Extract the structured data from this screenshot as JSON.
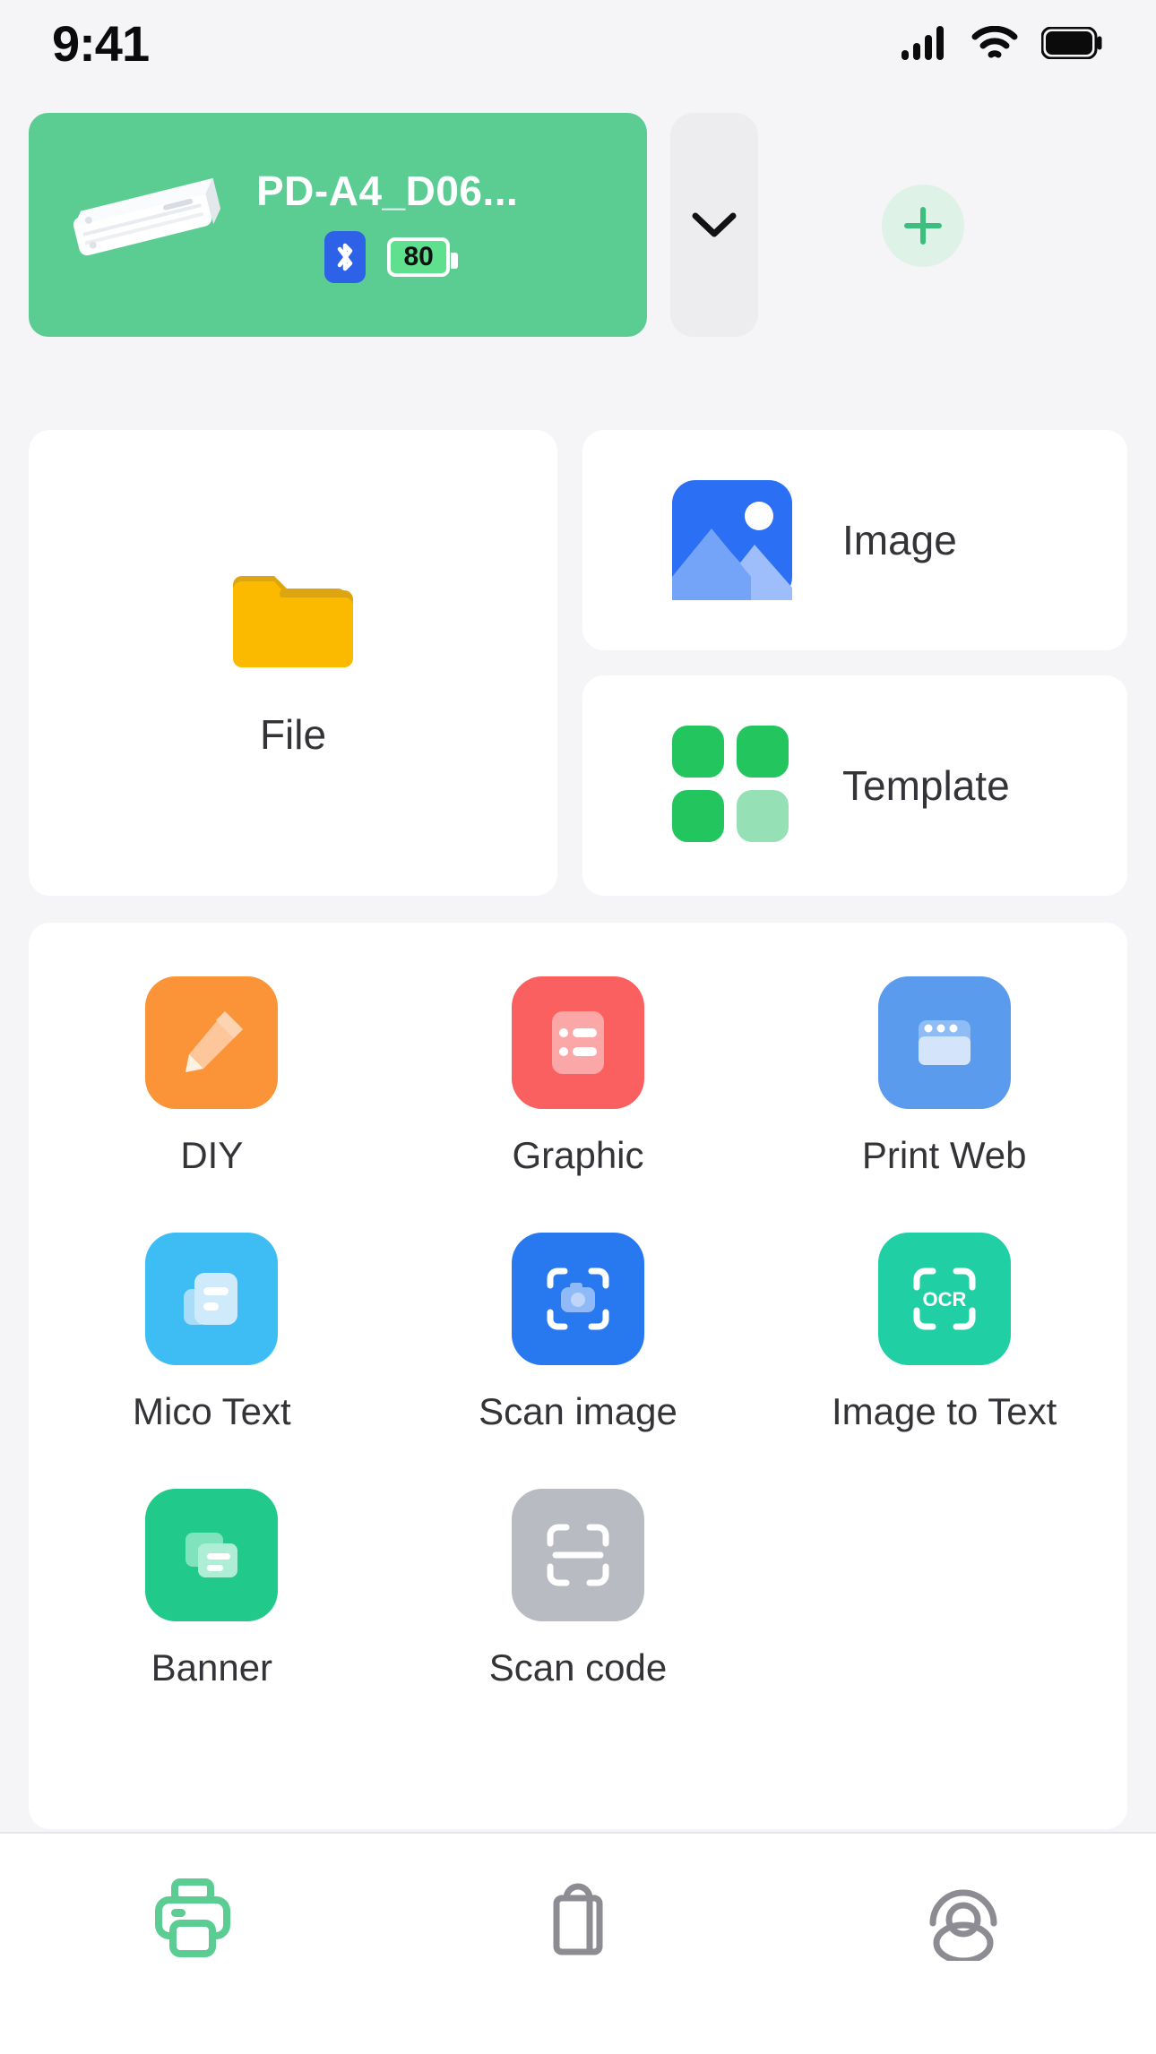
{
  "status_bar": {
    "time": "9:41",
    "icons": [
      "signal-icon",
      "wifi-icon",
      "battery-icon"
    ]
  },
  "device": {
    "name": "PD-A4_D06...",
    "product_image": "printer-illustration",
    "bluetooth_icon": "bluetooth-icon",
    "battery_level": "80",
    "expand_icon": "chevron-down-icon",
    "add_icon": "plus-icon",
    "card_color": "#5BCC92",
    "bluetooth_color": "#2D61E8",
    "battery_color": "#5FE08F",
    "add_button_color": "#DFF2E7"
  },
  "quick_actions": {
    "file": {
      "label": "File",
      "icon": "folder-icon",
      "color": "#FBB900"
    },
    "image": {
      "label": "Image",
      "icon": "photo-icon",
      "color": "#2B6FF4"
    },
    "template": {
      "label": "Template",
      "icon": "grid-squares-icon",
      "color": "#22C55E"
    }
  },
  "tools": [
    [
      {
        "label": "DIY",
        "icon": "pencil-icon",
        "color": "#FB9438"
      },
      {
        "label": "Graphic",
        "icon": "list-document-icon",
        "color": "#FB6060"
      },
      {
        "label": "Print Web",
        "icon": "browser-window-icon",
        "color": "#5A9BEE"
      }
    ],
    [
      {
        "label": "Mico Text",
        "icon": "text-document-icon",
        "color": "#3EBDF4"
      },
      {
        "label": "Scan image",
        "icon": "scan-camera-icon",
        "color": "#2879F0"
      },
      {
        "label": "Image to Text",
        "icon": "ocr-icon",
        "color": "#21CFA5"
      }
    ],
    [
      {
        "label": "Banner",
        "icon": "banner-cards-icon",
        "color": "#21C98A"
      },
      {
        "label": "Scan code",
        "icon": "scan-barcode-icon",
        "color": "#B8BBC2"
      }
    ]
  ],
  "tab_bar": {
    "active_color": "#5BCC92",
    "inactive_color": "#8C8C92",
    "tabs": [
      {
        "name": "print",
        "icon": "printer-icon",
        "active": true
      },
      {
        "name": "store",
        "icon": "shopping-bag-icon",
        "active": false
      },
      {
        "name": "account",
        "icon": "user-icon",
        "active": false
      }
    ]
  }
}
